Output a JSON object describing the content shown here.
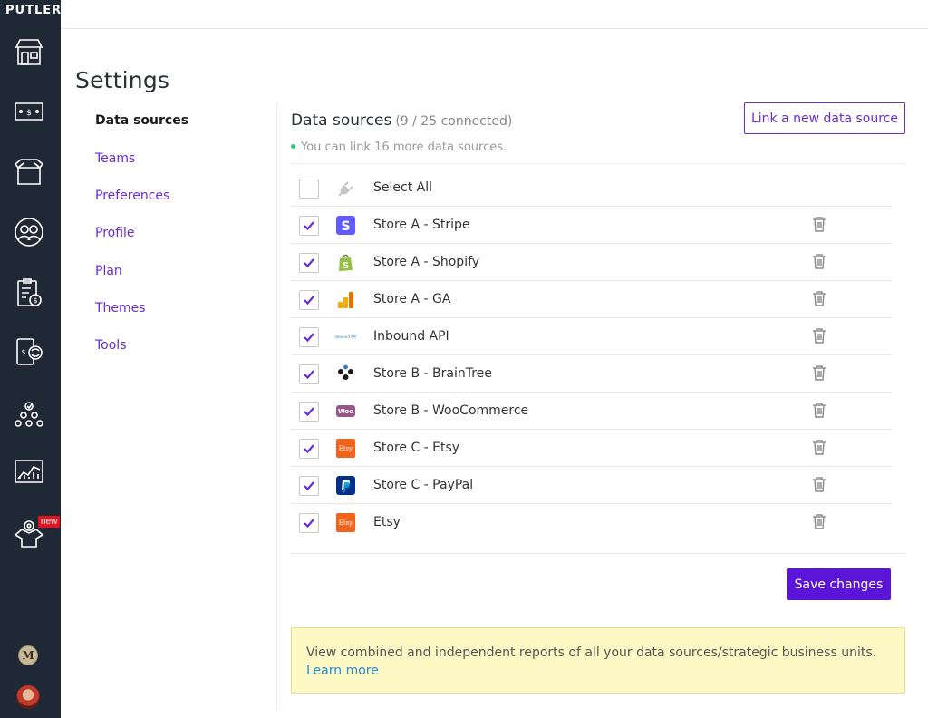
{
  "brand": "PUTLER",
  "sidebar": {
    "icons": [
      "store-icon",
      "money-icon",
      "box-icon",
      "customers-icon",
      "report-icon",
      "subscription-icon",
      "team-icon",
      "chart-icon",
      "addons-icon"
    ],
    "new_badge": "new",
    "workspace_initial": "M"
  },
  "page_title": "Settings",
  "menu": [
    {
      "label": "Data sources",
      "active": true
    },
    {
      "label": "Teams",
      "active": false
    },
    {
      "label": "Preferences",
      "active": false
    },
    {
      "label": "Profile",
      "active": false
    },
    {
      "label": "Plan",
      "active": false
    },
    {
      "label": "Themes",
      "active": false
    },
    {
      "label": "Tools",
      "active": false
    }
  ],
  "data_sources": {
    "title": "Data sources",
    "count": "(9 / 25 connected)",
    "note": "You can link 16 more data sources.",
    "link_button": "Link a new data source",
    "select_all": "Select All",
    "items": [
      {
        "label": "Store A - Stripe",
        "icon": "stripe-icon",
        "checked": true
      },
      {
        "label": "Store A - Shopify",
        "icon": "shopify-icon",
        "checked": true
      },
      {
        "label": "Store A - GA",
        "icon": "google-analytics-icon",
        "checked": true
      },
      {
        "label": "Inbound API",
        "icon": "inbound-api-icon",
        "checked": true,
        "icon_text": "Inbound API"
      },
      {
        "label": "Store B - BrainTree",
        "icon": "braintree-icon",
        "checked": true
      },
      {
        "label": "Store B - WooCommerce",
        "icon": "woocommerce-icon",
        "checked": true,
        "icon_text": "Woo"
      },
      {
        "label": "Store C - Etsy",
        "icon": "etsy-icon",
        "checked": true,
        "icon_text": "Etsy"
      },
      {
        "label": "Store C - PayPal",
        "icon": "paypal-icon",
        "checked": true
      },
      {
        "label": "Etsy",
        "icon": "etsy-icon",
        "checked": true,
        "icon_text": "Etsy"
      }
    ],
    "save_button": "Save changes"
  },
  "info": {
    "text": "View combined and independent reports of all your data sources/strategic business units. ",
    "link": "Learn more"
  },
  "colors": {
    "sidebar_bg": "#1f2936",
    "accent": "#6a2bd9",
    "save_bg": "#5b14d9",
    "info_bg": "#fdf8c4",
    "link": "#2a8bd0"
  }
}
